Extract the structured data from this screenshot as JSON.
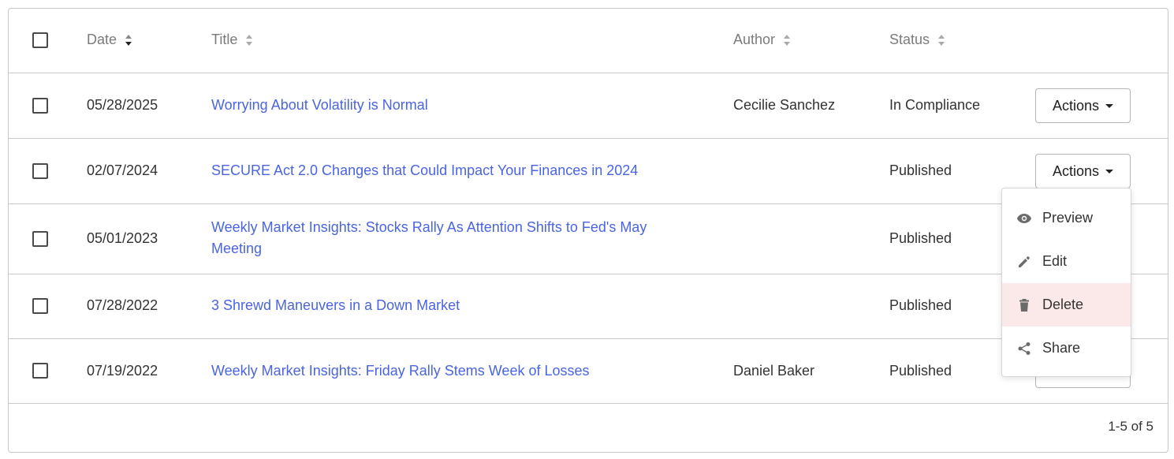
{
  "table": {
    "headers": {
      "date": "Date",
      "title": "Title",
      "author": "Author",
      "status": "Status"
    },
    "rows": [
      {
        "date": "05/28/2025",
        "title": "Worrying About Volatility is Normal",
        "author": "Cecilie Sanchez",
        "status": "In Compliance",
        "action": "Actions"
      },
      {
        "date": "02/07/2024",
        "title": "SECURE Act 2.0 Changes that Could Impact Your Finances in 2024",
        "author": "",
        "status": "Published",
        "action": "Actions"
      },
      {
        "date": "05/01/2023",
        "title": "Weekly Market Insights: Stocks Rally As Attention Shifts to Fed's May Meeting",
        "author": "",
        "status": "Published",
        "action": ""
      },
      {
        "date": "07/28/2022",
        "title": "3 Shrewd Maneuvers in a Down Market",
        "author": "",
        "status": "Published",
        "action": ""
      },
      {
        "date": "07/19/2022",
        "title": "Weekly Market Insights: Friday Rally Stems Week of Losses",
        "author": "Daniel Baker",
        "status": "Published",
        "action": ""
      }
    ]
  },
  "pagination": {
    "text": "1-5 of 5"
  },
  "actions_menu": {
    "items": [
      {
        "label": "Preview",
        "icon": "eye-icon"
      },
      {
        "label": "Edit",
        "icon": "pencil-icon"
      },
      {
        "label": "Delete",
        "icon": "trash-icon",
        "highlighted": true
      },
      {
        "label": "Share",
        "icon": "share-icon"
      }
    ]
  },
  "colors": {
    "link": "#4a64e3",
    "header_text": "#7b7b7b",
    "border": "#c9c9c9",
    "delete_highlight": "#fbe9e9"
  }
}
